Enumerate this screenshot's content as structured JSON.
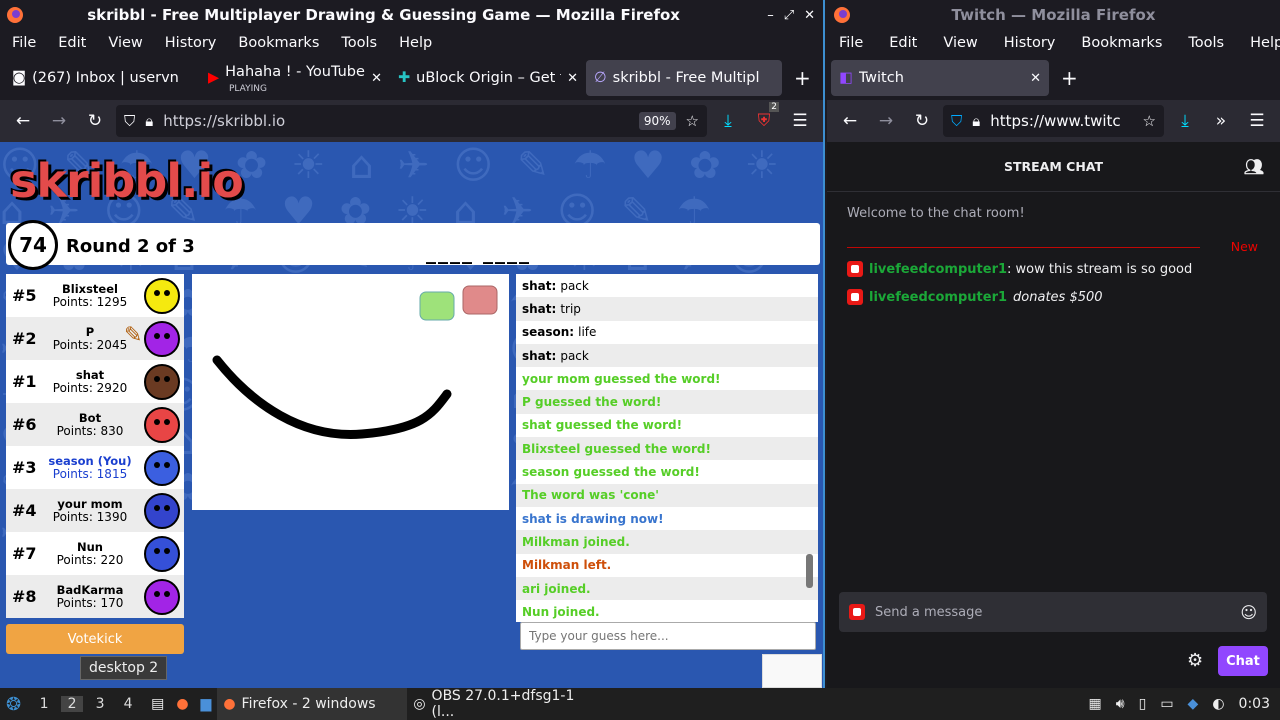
{
  "left_window": {
    "title": "skribbl - Free Multiplayer Drawing & Guessing Game — Mozilla Firefox",
    "menu": [
      "File",
      "Edit",
      "View",
      "History",
      "Bookmarks",
      "Tools",
      "Help"
    ],
    "tabs": [
      {
        "label": "(267) Inbox | uservn",
        "icon": "mail-icon"
      },
      {
        "label": "Hahaha ! - YouTube",
        "sub": "PLAYING",
        "icon": "youtube-icon"
      },
      {
        "label": "uBlock Origin – Get t",
        "icon": "puzzle-icon"
      },
      {
        "label": "skribbl - Free Multipl",
        "icon": "skribbl-icon"
      }
    ],
    "url": "https://skribbl.io",
    "zoom": "90%",
    "ext_badge": "2"
  },
  "skribbl": {
    "logo": "skribbl.io",
    "timer": "74",
    "round": "Round 2 of 3",
    "hint": "____ ____",
    "players": [
      {
        "rank": "#5",
        "name": "Blixsteel",
        "points": "Points: 1295",
        "color": "#f5e90f"
      },
      {
        "rank": "#2",
        "name": "P",
        "points": "Points: 2045",
        "color": "#a224e6"
      },
      {
        "rank": "#1",
        "name": "shat",
        "points": "Points: 2920",
        "color": "#6a3a22"
      },
      {
        "rank": "#6",
        "name": "Bot",
        "points": "Points: 830",
        "color": "#e84545"
      },
      {
        "rank": "#3",
        "name": "season (You)",
        "points": "Points: 1815",
        "color": "#3b5fe0"
      },
      {
        "rank": "#4",
        "name": "your mom",
        "points": "Points: 1390",
        "color": "#3344cc"
      },
      {
        "rank": "#7",
        "name": "Nun",
        "points": "Points: 220",
        "color": "#3550d8"
      },
      {
        "rank": "#8",
        "name": "BadKarma",
        "points": "Points: 170",
        "color": "#a224e6"
      }
    ],
    "votekick": "Votekick",
    "chat": [
      {
        "user": "shat:",
        "text": "pack",
        "type": "normal"
      },
      {
        "user": "shat:",
        "text": "trip",
        "type": "normal"
      },
      {
        "user": "season:",
        "text": "life",
        "type": "normal"
      },
      {
        "user": "shat:",
        "text": "pack",
        "type": "normal"
      },
      {
        "user": "",
        "text": "your mom guessed the word!",
        "type": "green"
      },
      {
        "user": "",
        "text": "P guessed the word!",
        "type": "green"
      },
      {
        "user": "",
        "text": "shat guessed the word!",
        "type": "green"
      },
      {
        "user": "",
        "text": "Blixsteel guessed the word!",
        "type": "green"
      },
      {
        "user": "",
        "text": "season guessed the word!",
        "type": "green"
      },
      {
        "user": "",
        "text": "The word was 'cone'",
        "type": "green"
      },
      {
        "user": "",
        "text": "shat is drawing now!",
        "type": "blue"
      },
      {
        "user": "",
        "text": "Milkman joined.",
        "type": "green"
      },
      {
        "user": "",
        "text": "Milkman left.",
        "type": "orange"
      },
      {
        "user": "",
        "text": "ari joined.",
        "type": "green"
      },
      {
        "user": "",
        "text": "Nun joined.",
        "type": "green"
      }
    ],
    "guess_placeholder": "Type your guess here...",
    "tooltip": "desktop 2"
  },
  "right_window": {
    "title": "Twitch — Mozilla Firefox",
    "menu": [
      "File",
      "Edit",
      "View",
      "History",
      "Bookmarks",
      "Tools",
      "Help"
    ],
    "tab": "Twitch",
    "url": "https://www.twitc"
  },
  "twitch": {
    "header": "STREAM CHAT",
    "welcome": "Welcome to the chat room!",
    "new_label": "New",
    "messages": [
      {
        "user": "livefeedcomputer1",
        "text": ": wow this stream is so good",
        "italic": false
      },
      {
        "user": "livefeedcomputer1",
        "text": "donates $500",
        "italic": true
      }
    ],
    "input_placeholder": "Send a message",
    "chat_button": "Chat"
  },
  "taskbar": {
    "desktops": [
      "1",
      "2",
      "3",
      "4"
    ],
    "active_desktop": "2",
    "firefox_task": "Firefox - 2 windows",
    "obs_task": "OBS 27.0.1+dfsg1-1 (l...",
    "clock": "0:03"
  }
}
